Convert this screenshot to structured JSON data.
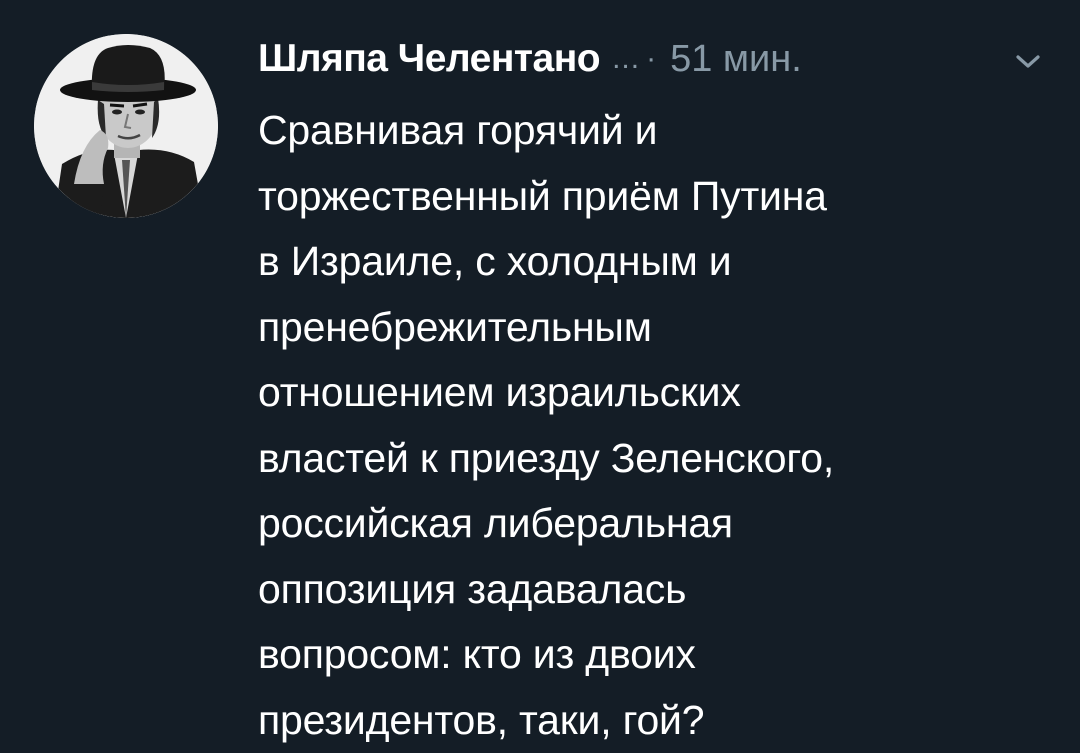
{
  "tweet": {
    "display_name": "Шляпа Челентано",
    "handle_truncated": "...",
    "separator": "·",
    "timestamp": "51 мин.",
    "avatar_icon": "user-avatar-icon",
    "caret_icon": "chevron-down-icon",
    "text": "Сравнивая горячий и\nторжественный приём Путина\nв Израиле, с холодным и\nпренебрежительным\nотношением израильских\nвластей к приезду  Зеленского,\nроссийская либеральная\nоппозиция задавалась\nвопросом: кто из двоих\nпрезидентов, таки, гой?"
  },
  "colors": {
    "background": "#141d26",
    "primary_text": "#ffffff",
    "secondary_text": "#8899a6"
  }
}
